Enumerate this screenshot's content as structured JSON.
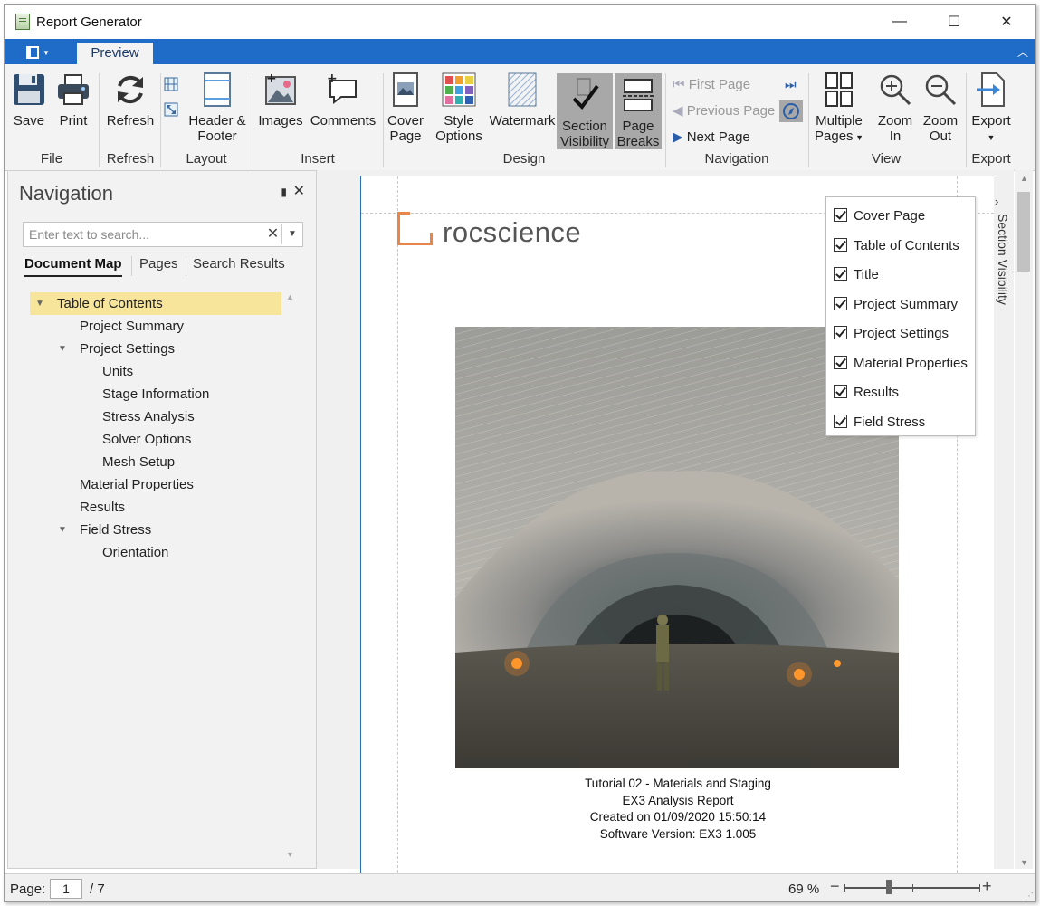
{
  "window": {
    "title": "Report Generator",
    "minimize": "—",
    "maximize": "☐",
    "close": "✕"
  },
  "ribbon_tabs": {
    "preview": "Preview",
    "collapse": "︿"
  },
  "ribbon": {
    "file": {
      "label": "File",
      "save": "Save",
      "print": "Print"
    },
    "refresh": {
      "label": "Refresh",
      "refresh": "Refresh"
    },
    "layout": {
      "label": "Layout",
      "header_footer_1": "Header &",
      "header_footer_2": "Footer"
    },
    "insert": {
      "label": "Insert",
      "images": "Images",
      "comments": "Comments"
    },
    "design": {
      "label": "Design",
      "cover_1": "Cover",
      "cover_2": "Page",
      "style_1": "Style",
      "style_2": "Options",
      "watermark": "Watermark",
      "section_1": "Section",
      "section_2": "Visibility",
      "breaks_1": "Page",
      "breaks_2": "Breaks"
    },
    "navigation": {
      "label": "Navigation",
      "first_page": "First Page",
      "previous_page": "Previous Page",
      "next_page": "Next Page"
    },
    "view": {
      "label": "View",
      "multiple_1": "Multiple",
      "multiple_2": "Pages",
      "zoom_in_1": "Zoom",
      "zoom_in_2": "In",
      "zoom_out_1": "Zoom",
      "zoom_out_2": "Out"
    },
    "export": {
      "label": "Export",
      "export": "Export"
    }
  },
  "nav_panel": {
    "title": "Navigation",
    "pin": "📌",
    "close": "✕",
    "search_placeholder": "Enter text to search...",
    "tabs": [
      "Document Map",
      "Pages",
      "Search Results"
    ],
    "tree": [
      {
        "label": "Table of Contents",
        "level": 0,
        "expanded": true,
        "selected": true
      },
      {
        "label": "Project Summary",
        "level": 1
      },
      {
        "label": "Project Settings",
        "level": 1,
        "expanded": true
      },
      {
        "label": "Units",
        "level": 2
      },
      {
        "label": "Stage Information",
        "level": 2
      },
      {
        "label": "Stress Analysis",
        "level": 2
      },
      {
        "label": "Solver Options",
        "level": 2
      },
      {
        "label": "Mesh Setup",
        "level": 2
      },
      {
        "label": "Material Properties",
        "level": 1
      },
      {
        "label": "Results",
        "level": 1
      },
      {
        "label": "Field Stress",
        "level": 1,
        "expanded": true
      },
      {
        "label": "Orientation",
        "level": 2
      }
    ]
  },
  "document": {
    "logo_text": "rocscience",
    "caption": {
      "line1": "Tutorial 02 - Materials and Staging",
      "line2": "EX3 Analysis Report",
      "line3": "Created on 01/09/2020 15:50:14",
      "line4": "Software Version: EX3 1.005"
    }
  },
  "section_visibility": {
    "side_label": "Section Visibility",
    "items": [
      {
        "label": "Cover Page",
        "checked": true
      },
      {
        "label": "Table of Contents",
        "checked": true
      },
      {
        "label": "Title",
        "checked": true
      },
      {
        "label": "Project Summary",
        "checked": true
      },
      {
        "label": "Project Settings",
        "checked": true
      },
      {
        "label": "Material Properties",
        "checked": true
      },
      {
        "label": "Results",
        "checked": true
      },
      {
        "label": "Field Stress",
        "checked": true
      }
    ]
  },
  "status": {
    "page_label": "Page:",
    "page_value": "1",
    "page_total": "/ 7",
    "zoom": "69 %"
  },
  "colors": {
    "ribbon_blue": "#1e6bc8",
    "accent_orange": "#e8854a",
    "selected_tree": "#f6e59b"
  }
}
